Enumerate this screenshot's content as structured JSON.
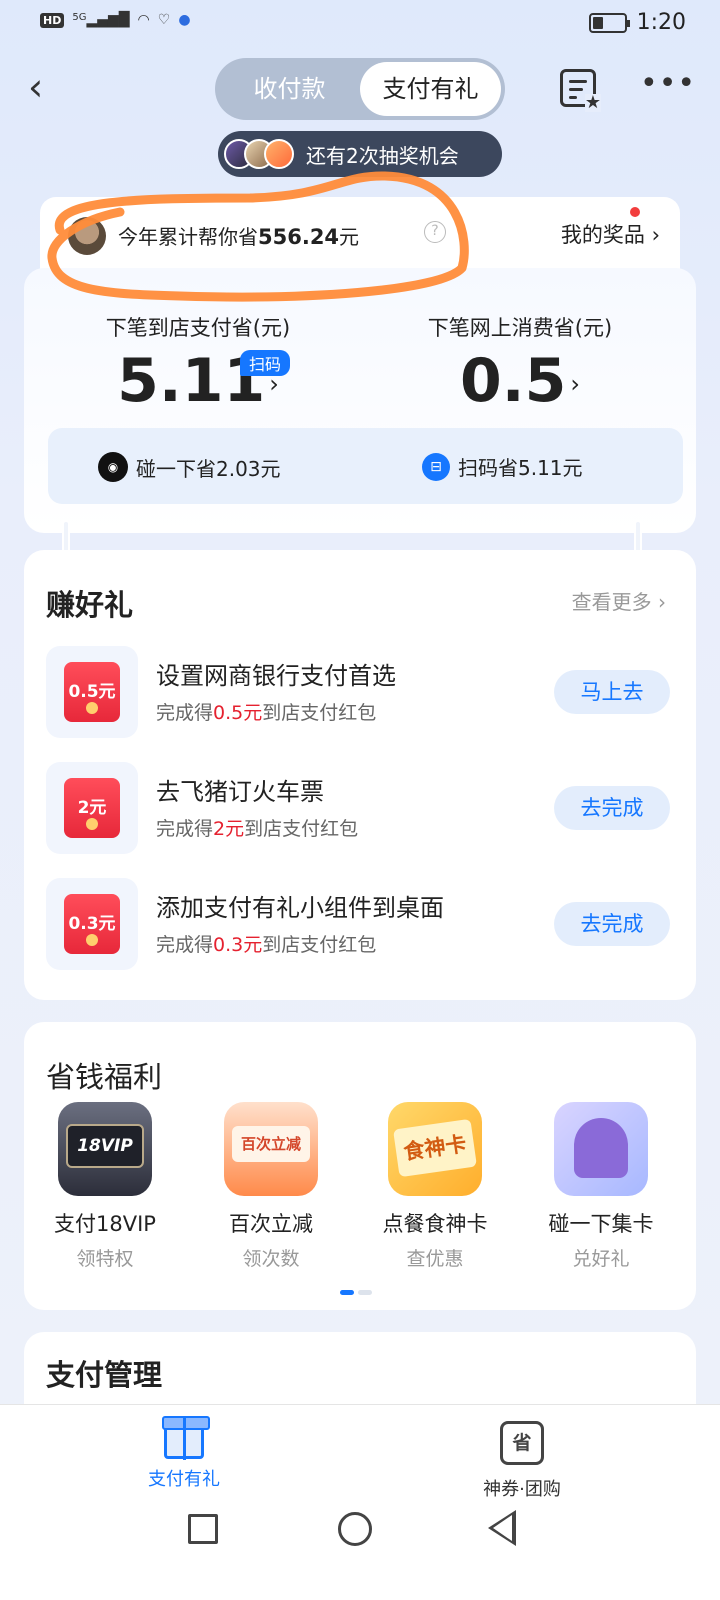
{
  "status_bar": {
    "network_badge": "HD",
    "signal": "5G",
    "time": "1:20"
  },
  "header": {
    "tabs": [
      {
        "label": "收付款",
        "active": false
      },
      {
        "label": "支付有礼",
        "active": true
      }
    ]
  },
  "lottery": {
    "text": "还有2次抽奖机会"
  },
  "savings_summary": {
    "prefix": "今年累计帮你省",
    "amount": "556.24",
    "suffix": "元",
    "prize_link": "我的奖品 ›"
  },
  "savings": {
    "store": {
      "label": "下笔到店支付省(元)",
      "value": "5.11",
      "tag": "扫码"
    },
    "online": {
      "label": "下笔网上消费省(元)",
      "value": "0.5"
    },
    "methods": [
      {
        "label": "碰一下省",
        "amount": "2.03元"
      },
      {
        "label": "扫码省",
        "amount": "5.11元"
      }
    ]
  },
  "earn_gifts": {
    "title": "赚好礼",
    "more": "查看更多 ›",
    "tasks": [
      {
        "title": "设置网商银行支付首选",
        "pre": "完成得",
        "reward": "0.5元",
        "post": "到店支付红包",
        "badge": "0.5元",
        "button": "马上去"
      },
      {
        "title": "去飞猪订火车票",
        "pre": "完成得",
        "reward": "2元",
        "post": "到店支付红包",
        "badge": "2元",
        "button": "去完成"
      },
      {
        "title": "添加支付有礼小组件到桌面",
        "pre": "完成得",
        "reward": "0.3元",
        "post": "到店支付红包",
        "badge": "0.3元",
        "button": "去完成"
      }
    ]
  },
  "benefits": {
    "title": "省钱福利",
    "items": [
      {
        "name": "支付18VIP",
        "sub": "领特权",
        "art": "18VIP"
      },
      {
        "name": "百次立减",
        "sub": "领次数",
        "art": "百次立减"
      },
      {
        "name": "点餐食神卡",
        "sub": "查优惠",
        "art": "食神卡"
      },
      {
        "name": "碰一下集卡",
        "sub": "兑好礼",
        "art": ""
      }
    ]
  },
  "payment_management": {
    "title": "支付管理"
  },
  "tabbar": {
    "items": [
      {
        "label": "支付有礼",
        "active": true
      },
      {
        "label": "神券·团购",
        "active": false,
        "icon_text": "省"
      }
    ]
  },
  "colors": {
    "accent": "#1677ff",
    "reward_red": "#e5212f",
    "annotation_orange": "#ff8c3a"
  }
}
